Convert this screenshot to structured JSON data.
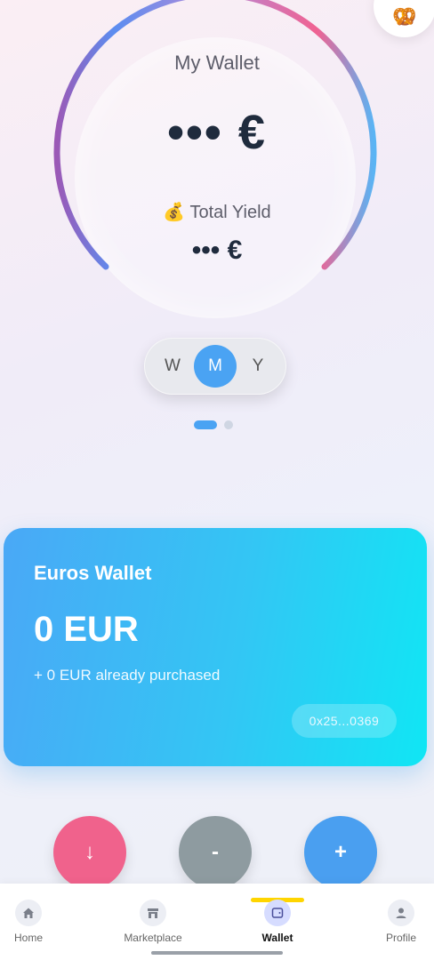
{
  "header": {
    "avatar_icon": "pretzel-avatar-icon"
  },
  "wallet": {
    "title": "My Wallet",
    "amount": "••• €",
    "yield_emoji": "💰",
    "yield_label": "Total Yield",
    "yield_amount": "••• €"
  },
  "period_toggle": {
    "options": [
      "W",
      "M",
      "Y"
    ],
    "selected": "M"
  },
  "pager": {
    "pages": 2,
    "current": 1
  },
  "euros_card": {
    "title": "Euros Wallet",
    "balance": "0 EUR",
    "purchased": "+ 0 EUR already purchased",
    "address": "0x25...0369"
  },
  "actions": {
    "receive": "↓",
    "withdraw": "-",
    "add": "+"
  },
  "tabbar": {
    "items": [
      {
        "label": "Home",
        "icon": "home-icon"
      },
      {
        "label": "Marketplace",
        "icon": "store-icon"
      },
      {
        "label": "Wallet",
        "icon": "wallet-icon"
      },
      {
        "label": "Profile",
        "icon": "profile-icon"
      }
    ],
    "active": "Wallet"
  },
  "colors": {
    "accent_blue": "#4aa3f3",
    "gauge_pink": "#f06292",
    "gauge_purple": "#9b59b6",
    "receive_button": "#f0628c",
    "withdraw_button": "#8e9ba0",
    "tab_indicator": "#ffd500"
  }
}
